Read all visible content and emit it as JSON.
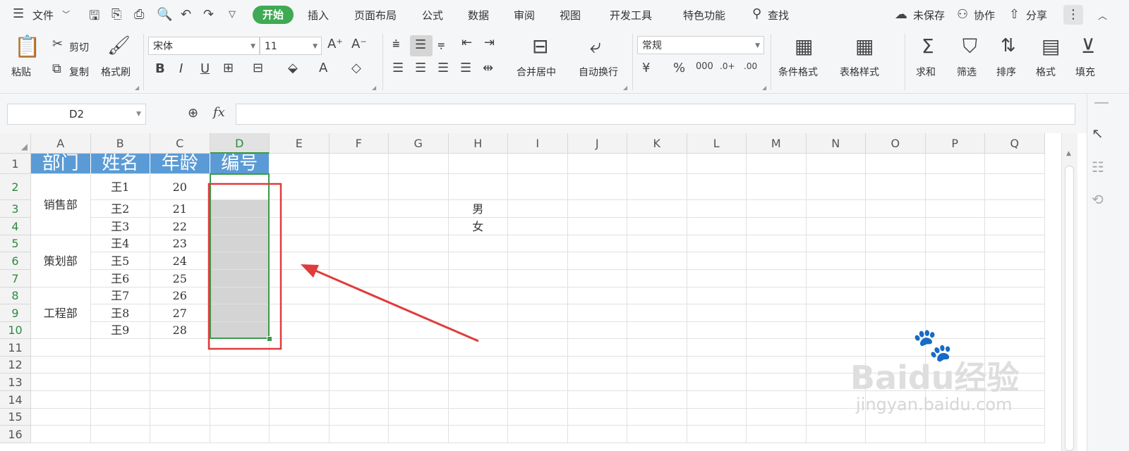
{
  "menu": {
    "file": "文件",
    "tabs": [
      "开始",
      "插入",
      "页面布局",
      "公式",
      "数据",
      "审阅",
      "视图",
      "开发工具",
      "特色功能"
    ],
    "search": "查找",
    "unsaved": "未保存",
    "collab": "协作",
    "share": "分享"
  },
  "ribbon": {
    "paste": "粘贴",
    "cut": "剪切",
    "copy": "复制",
    "format_painter": "格式刷",
    "font": "宋体",
    "font_size": "11",
    "merge_center": "合并居中",
    "wrap_text": "自动换行",
    "number_format": "常规",
    "cond_format": "条件格式",
    "table_style": "表格样式",
    "sum": "求和",
    "filter": "筛选",
    "sort": "排序",
    "format": "格式",
    "fill": "填充"
  },
  "formula_bar": {
    "name_box": "D2",
    "fx": "fx",
    "value": ""
  },
  "sheet": {
    "columns": [
      "A",
      "B",
      "C",
      "D",
      "E",
      "F",
      "G",
      "H",
      "I",
      "J",
      "K",
      "L",
      "M",
      "N",
      "O",
      "P",
      "Q"
    ],
    "rows": [
      "1",
      "2",
      "3",
      "4",
      "5",
      "6",
      "7",
      "8",
      "9",
      "10",
      "11",
      "12",
      "13",
      "14",
      "15",
      "16"
    ],
    "selected_col": "D",
    "selected_rows": [
      "2",
      "3",
      "4",
      "5",
      "6",
      "7",
      "8",
      "9",
      "10"
    ],
    "header": [
      "部门",
      "姓名",
      "年龄",
      "编号"
    ],
    "departments": [
      "销售部",
      "策划部",
      "工程部"
    ],
    "names": [
      "王1",
      "王2",
      "王3",
      "王4",
      "王5",
      "王6",
      "王7",
      "王8",
      "王9"
    ],
    "ages": [
      "20",
      "21",
      "22",
      "23",
      "24",
      "25",
      "26",
      "27",
      "28"
    ],
    "h3": "男",
    "h4": "女"
  },
  "watermark": {
    "brand": "Baidu经验",
    "url": "jingyan.baidu.com"
  },
  "colors": {
    "accent": "#3eaa53",
    "header_fill": "#5b9bd5",
    "annotation": "#e03c3c"
  }
}
